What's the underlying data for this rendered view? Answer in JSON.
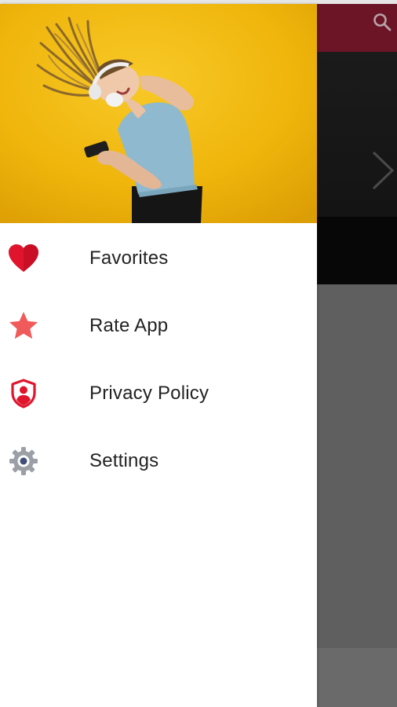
{
  "drawer": {
    "menu": [
      {
        "label": "Favorites",
        "icon": "heart-icon",
        "color": "#e0152d"
      },
      {
        "label": "Rate App",
        "icon": "star-icon",
        "color": "#f05a5a"
      },
      {
        "label": "Privacy Policy",
        "icon": "shield-user-icon",
        "color": "#e0152d"
      },
      {
        "label": "Settings",
        "icon": "gear-icon",
        "color": "#8e949b"
      }
    ]
  },
  "colors": {
    "toolbar": "#6b1526",
    "header_background": "#efb50a",
    "drawer_background": "#ffffff",
    "scrim": "#5f5f5f"
  },
  "icons": {
    "toolbar_search": "search-icon",
    "carousel_next": "chevron-right-icon"
  }
}
